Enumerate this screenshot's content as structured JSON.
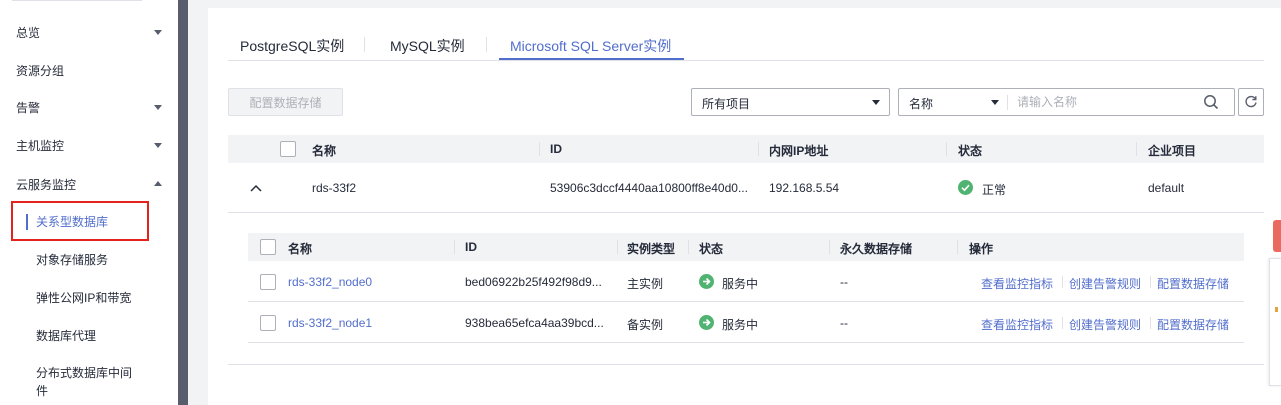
{
  "sidebar": {
    "items": [
      {
        "label": "总览",
        "caret": "down"
      },
      {
        "label": "资源分组",
        "caret": ""
      },
      {
        "label": "告警",
        "caret": "down"
      },
      {
        "label": "主机监控",
        "caret": "down"
      },
      {
        "label": "云服务监控",
        "caret": "up"
      }
    ],
    "sub_items": [
      {
        "label": "关系型数据库",
        "active": true
      },
      {
        "label": "对象存储服务"
      },
      {
        "label": "弹性公网IP和带宽"
      },
      {
        "label": "数据库代理"
      },
      {
        "label": "分布式数据库中间件"
      }
    ],
    "sub_item_wrap": {
      "line1": "分布式数据库中间",
      "line2": "件"
    }
  },
  "tabs": [
    {
      "label": "PostgreSQL实例",
      "active": false
    },
    {
      "label": "MySQL实例",
      "active": false
    },
    {
      "label": "Microsoft SQL Server实例",
      "active": true
    }
  ],
  "toolbar": {
    "config_button": "配置数据存储",
    "project_select": "所有项目",
    "search_field_select": "名称",
    "search_placeholder": "请输入名称"
  },
  "main_table": {
    "headers": {
      "name": "名称",
      "id": "ID",
      "ip": "内网IP地址",
      "status": "状态",
      "project": "企业项目"
    },
    "row": {
      "name": "rds-33f2",
      "id": "53906c3dccf4440aa10800ff8e40d0...",
      "ip": "192.168.5.54",
      "status": "正常",
      "project": "default"
    }
  },
  "sub_table": {
    "headers": {
      "name": "名称",
      "id": "ID",
      "type": "实例类型",
      "status": "状态",
      "storage": "永久数据存储",
      "ops": "操作"
    },
    "rows": [
      {
        "name": "rds-33f2_node0",
        "id": "bed06922b25f492f98d9...",
        "type": "主实例",
        "status": "服务中",
        "storage": "--"
      },
      {
        "name": "rds-33f2_node1",
        "id": "938bea65efca4aa39bcd...",
        "type": "备实例",
        "status": "服务中",
        "storage": "--"
      }
    ],
    "ops": {
      "view": "查看监控指标",
      "create": "创建告警规则",
      "config": "配置数据存储"
    }
  },
  "colors": {
    "accent": "#526ecc",
    "success": "#50b371",
    "highlight": "#e4231f"
  }
}
